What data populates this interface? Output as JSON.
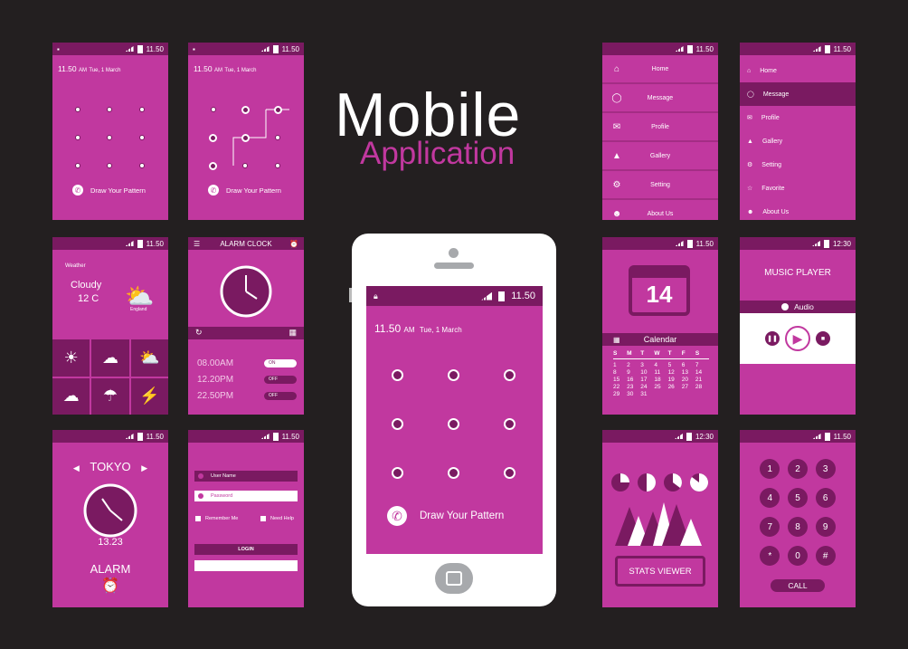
{
  "title": {
    "main": "Mobile",
    "sub": "Application"
  },
  "status": {
    "time": "11.50",
    "time_alt": "12:30"
  },
  "lock_screen": {
    "time": "11.50",
    "ampm": "AM",
    "date": "Tue, 1 March",
    "pattern_label": "Draw Your Pattern"
  },
  "menu_simple": {
    "items": [
      "Home",
      "Message",
      "Profile",
      "Gallery",
      "Setting",
      "About Us"
    ]
  },
  "menu_full": {
    "items": [
      "Home",
      "Message",
      "Profile",
      "Gallery",
      "Setting",
      "Favorite",
      "About Us"
    ],
    "selected": "Message"
  },
  "weather": {
    "label": "Weather",
    "condition": "Cloudy",
    "temp": "12 C",
    "location": "England"
  },
  "alarm_clock": {
    "title": "ALARM CLOCK",
    "alarms": [
      {
        "time": "08.00AM",
        "state": "ON"
      },
      {
        "time": "12.20PM",
        "state": "OFF"
      },
      {
        "time": "22.50PM",
        "state": "OFF"
      }
    ]
  },
  "calendar": {
    "day": "14",
    "title": "Calendar",
    "weekdays": [
      "S",
      "M",
      "T",
      "W",
      "T",
      "F",
      "S"
    ],
    "rows": [
      [
        "1",
        "2",
        "3",
        "4",
        "5",
        "6",
        "7"
      ],
      [
        "8",
        "9",
        "10",
        "11",
        "12",
        "13",
        "14"
      ],
      [
        "15",
        "16",
        "17",
        "18",
        "19",
        "20",
        "21"
      ],
      [
        "22",
        "23",
        "24",
        "25",
        "26",
        "27",
        "28"
      ],
      [
        "29",
        "30",
        "31",
        "",
        "",
        "",
        ""
      ]
    ]
  },
  "music": {
    "title": "MUSIC PLAYER",
    "source": "Audio"
  },
  "world_clock": {
    "city": "TOKYO",
    "time": "13.23",
    "alarm_label": "ALARM"
  },
  "login": {
    "username_placeholder": "User Name",
    "password_placeholder": "Password",
    "remember": "Remember Me",
    "help": "Need Help",
    "button": "LOGIN"
  },
  "stats": {
    "button": "STATS VIEWER"
  },
  "dialer": {
    "keys": [
      "1",
      "2",
      "3",
      "4",
      "5",
      "6",
      "7",
      "8",
      "9",
      "*",
      "0",
      "#"
    ],
    "call": "CALL"
  },
  "colors": {
    "bg": "#231f20",
    "accent": "#c1389f",
    "dark": "#7a1a61"
  }
}
